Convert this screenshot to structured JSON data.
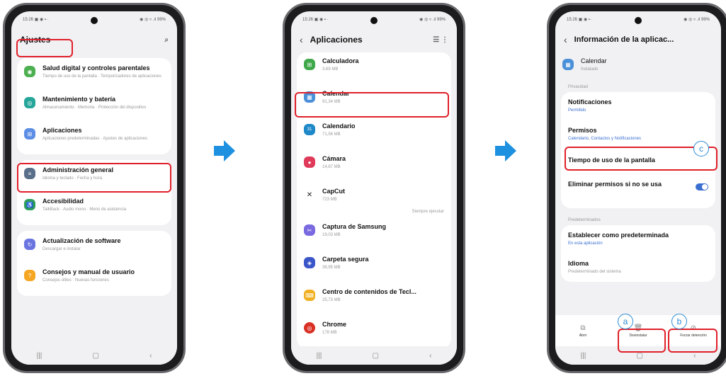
{
  "status": {
    "time": "15:26 ▣ ◉ ▪ ·",
    "right": "◉ ◎ ▿ .ıl 99%"
  },
  "screen1": {
    "title": "Ajustes",
    "search_icon": "⌕",
    "items": [
      {
        "label": "Salud digital y controles parentales",
        "sub": "Tiempo de uso de la pantalla · Temporizadores de aplicaciones",
        "color": "#4caf50",
        "glyph": "◉"
      },
      {
        "label": "Mantenimiento y batería",
        "sub": "Almacenamiento · Memoria · Protección del dispositivo",
        "color": "#26a69a",
        "glyph": "◎"
      },
      {
        "label": "Aplicaciones",
        "sub": "Aplicaciones predeterminadas · Ajustes de aplicaciones",
        "color": "#5c8ee6",
        "glyph": "⊞"
      },
      {
        "label": "Administración general",
        "sub": "Idioma y teclado · Fecha y hora",
        "color": "#5a6f8a",
        "glyph": "≡"
      },
      {
        "label": "Accesibilidad",
        "sub": "TalkBack · Audio mono · Menú de asistencia",
        "color": "#2e9e5a",
        "glyph": "♿"
      },
      {
        "label": "Actualización de software",
        "sub": "Descargar e instalar",
        "color": "#6a75e0",
        "glyph": "↻"
      },
      {
        "label": "Consejos y manual de usuario",
        "sub": "Consejos útiles · Nuevas funciones",
        "color": "#f5a623",
        "glyph": "?"
      }
    ]
  },
  "screen2": {
    "title": "Aplicaciones",
    "back": "‹",
    "icons_right": "☰  ⋮",
    "apps": [
      {
        "label": "Calculadora",
        "sub": "3,69 MB",
        "color": "#3ea84a",
        "glyph": "⊞"
      },
      {
        "label": "Calendar",
        "sub": "91,34 MB",
        "color": "#4a90d9",
        "glyph": "▦"
      },
      {
        "label": "Calendario",
        "sub": "71,56 MB",
        "color": "#1e88c8",
        "glyph": "31"
      },
      {
        "label": "Cámara",
        "sub": "14,67 MB",
        "color": "#e03a5a",
        "glyph": "●"
      },
      {
        "label": "CapCut",
        "sub": "723 MB",
        "color": "#222222",
        "glyph": "✕",
        "extra": "Siempre ejecutar"
      },
      {
        "label": "Captura de Samsung",
        "sub": "19,03 MB",
        "color": "#7a6ae0",
        "glyph": "✂"
      },
      {
        "label": "Carpeta segura",
        "sub": "38,95 MB",
        "color": "#3a56c8",
        "glyph": "◈"
      },
      {
        "label": "Centro de contenidos de Tecl...",
        "sub": "25,73 MB",
        "color": "#f0b020",
        "glyph": "⌨"
      },
      {
        "label": "Chrome",
        "sub": "178 MB",
        "color": "#d93025",
        "glyph": "◎"
      }
    ]
  },
  "screen3": {
    "title": "Información de la aplicac...",
    "back": "‹",
    "app_name": "Calendar",
    "app_sub": "Instalado",
    "section1": "Privacidad",
    "notifications": {
      "label": "Notificaciones",
      "sub": "Permitido"
    },
    "permissions": {
      "label": "Permisos",
      "sub": "Calendario, Contactos y Notificaciones"
    },
    "screen_time": "Tiempo de uso de la pantalla",
    "remove_perms": "Eliminar permisos si no se usa",
    "section2": "Predeterminados",
    "set_default": {
      "label": "Establecer como predeterminada",
      "sub": "En esta aplicación"
    },
    "language": {
      "label": "Idioma",
      "sub": "Predeterminado del sistema"
    },
    "bottom": [
      {
        "label": "Abrir",
        "glyph": "⧉"
      },
      {
        "label": "Desinstalar",
        "glyph": "🗑"
      },
      {
        "label": "Forzar detención",
        "glyph": "⊘"
      }
    ]
  },
  "badges": {
    "a": "a",
    "b": "b",
    "c": "c"
  },
  "nav": {
    "recent": "|||",
    "home": "▢",
    "back": "‹"
  },
  "colors": {
    "highlight": "#e0202a",
    "arrow": "#1e90e0",
    "badge": "#2a8ad4"
  }
}
